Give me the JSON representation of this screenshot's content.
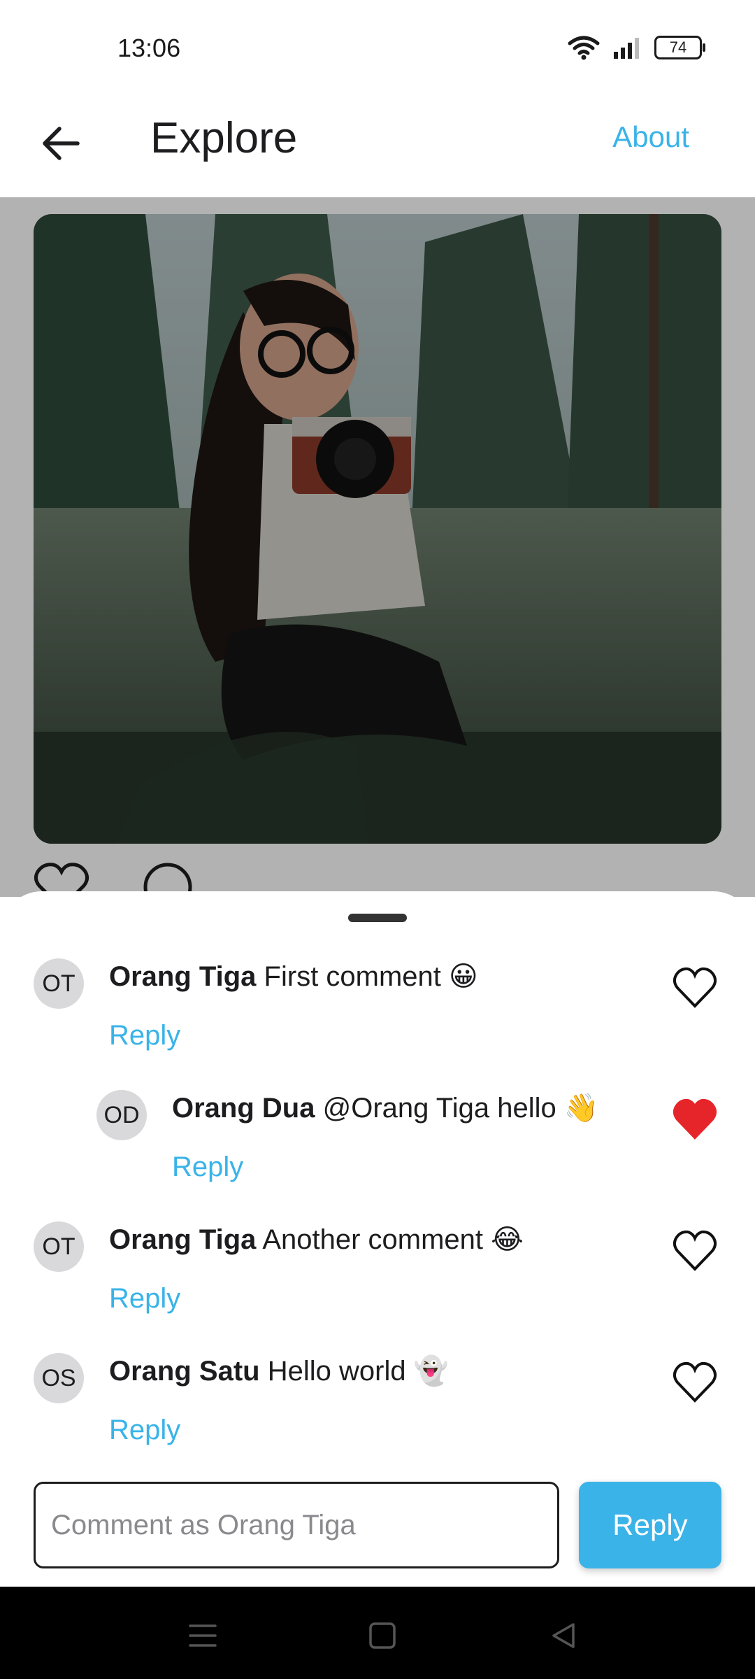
{
  "status_bar": {
    "time": "13:06",
    "battery": "74"
  },
  "header": {
    "title": "Explore",
    "about_label": "About"
  },
  "comments": [
    {
      "initials": "OT",
      "author": "Orang Tiga",
      "text": "First comment 😀",
      "reply_label": "Reply",
      "liked": false
    },
    {
      "initials": "OD",
      "author": "Orang Dua",
      "text": "@Orang Tiga hello 👋",
      "reply_label": "Reply",
      "liked": true
    },
    {
      "initials": "OT",
      "author": "Orang Tiga",
      "text": "Another comment 😂",
      "reply_label": "Reply",
      "liked": false
    },
    {
      "initials": "OS",
      "author": "Orang Satu",
      "text": "Hello world 👻",
      "reply_label": "Reply",
      "liked": false
    }
  ],
  "composer": {
    "placeholder": "Comment as Orang Tiga",
    "submit_label": "Reply"
  },
  "colors": {
    "accent": "#3ab3e8",
    "like_active": "#e5252a"
  }
}
